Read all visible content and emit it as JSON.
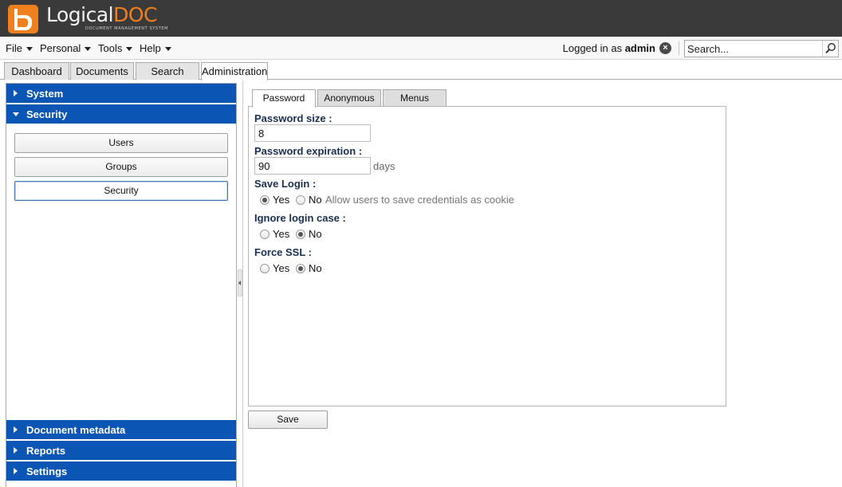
{
  "app": {
    "logo_word": "Logical",
    "logo_accent": "DOC",
    "logo_tagline": "DOCUMENT MANAGEMENT SYSTEM",
    "brand_color": "#f07f1d",
    "accent_color": "#0b56b4"
  },
  "menu": {
    "items": [
      "File",
      "Personal",
      "Tools",
      "Help"
    ],
    "logged_in_prefix": "Logged in as",
    "user": "admin",
    "logout_icon": "close-circle-icon",
    "search_placeholder": "Search...",
    "search_icon": "magnifier-icon"
  },
  "top_tabs": [
    "Dashboard",
    "Documents",
    "Search",
    "Administration"
  ],
  "top_tabs_active": "Administration",
  "sidebar": {
    "sections": [
      "System",
      "Security",
      "Document metadata",
      "Reports",
      "Settings"
    ],
    "expanded": "Security",
    "security_items": [
      "Users",
      "Groups",
      "Security"
    ],
    "selected_item": "Security"
  },
  "content": {
    "tabs": [
      "Password",
      "Anonymous",
      "Menus"
    ],
    "active_tab": "Password",
    "password_size": {
      "label": "Password size :",
      "value": "8"
    },
    "password_expiration": {
      "label": "Password expiration :",
      "value": "90",
      "unit": "days"
    },
    "save_login": {
      "label": "Save Login :",
      "options": [
        "Yes",
        "No"
      ],
      "selected": "Yes",
      "hint": "Allow users to save credentials as cookie"
    },
    "ignore_login_case": {
      "label": "Ignore login case :",
      "options": [
        "Yes",
        "No"
      ],
      "selected": "No"
    },
    "force_ssl": {
      "label": "Force SSL :",
      "options": [
        "Yes",
        "No"
      ],
      "selected": "No"
    },
    "save_label": "Save"
  }
}
